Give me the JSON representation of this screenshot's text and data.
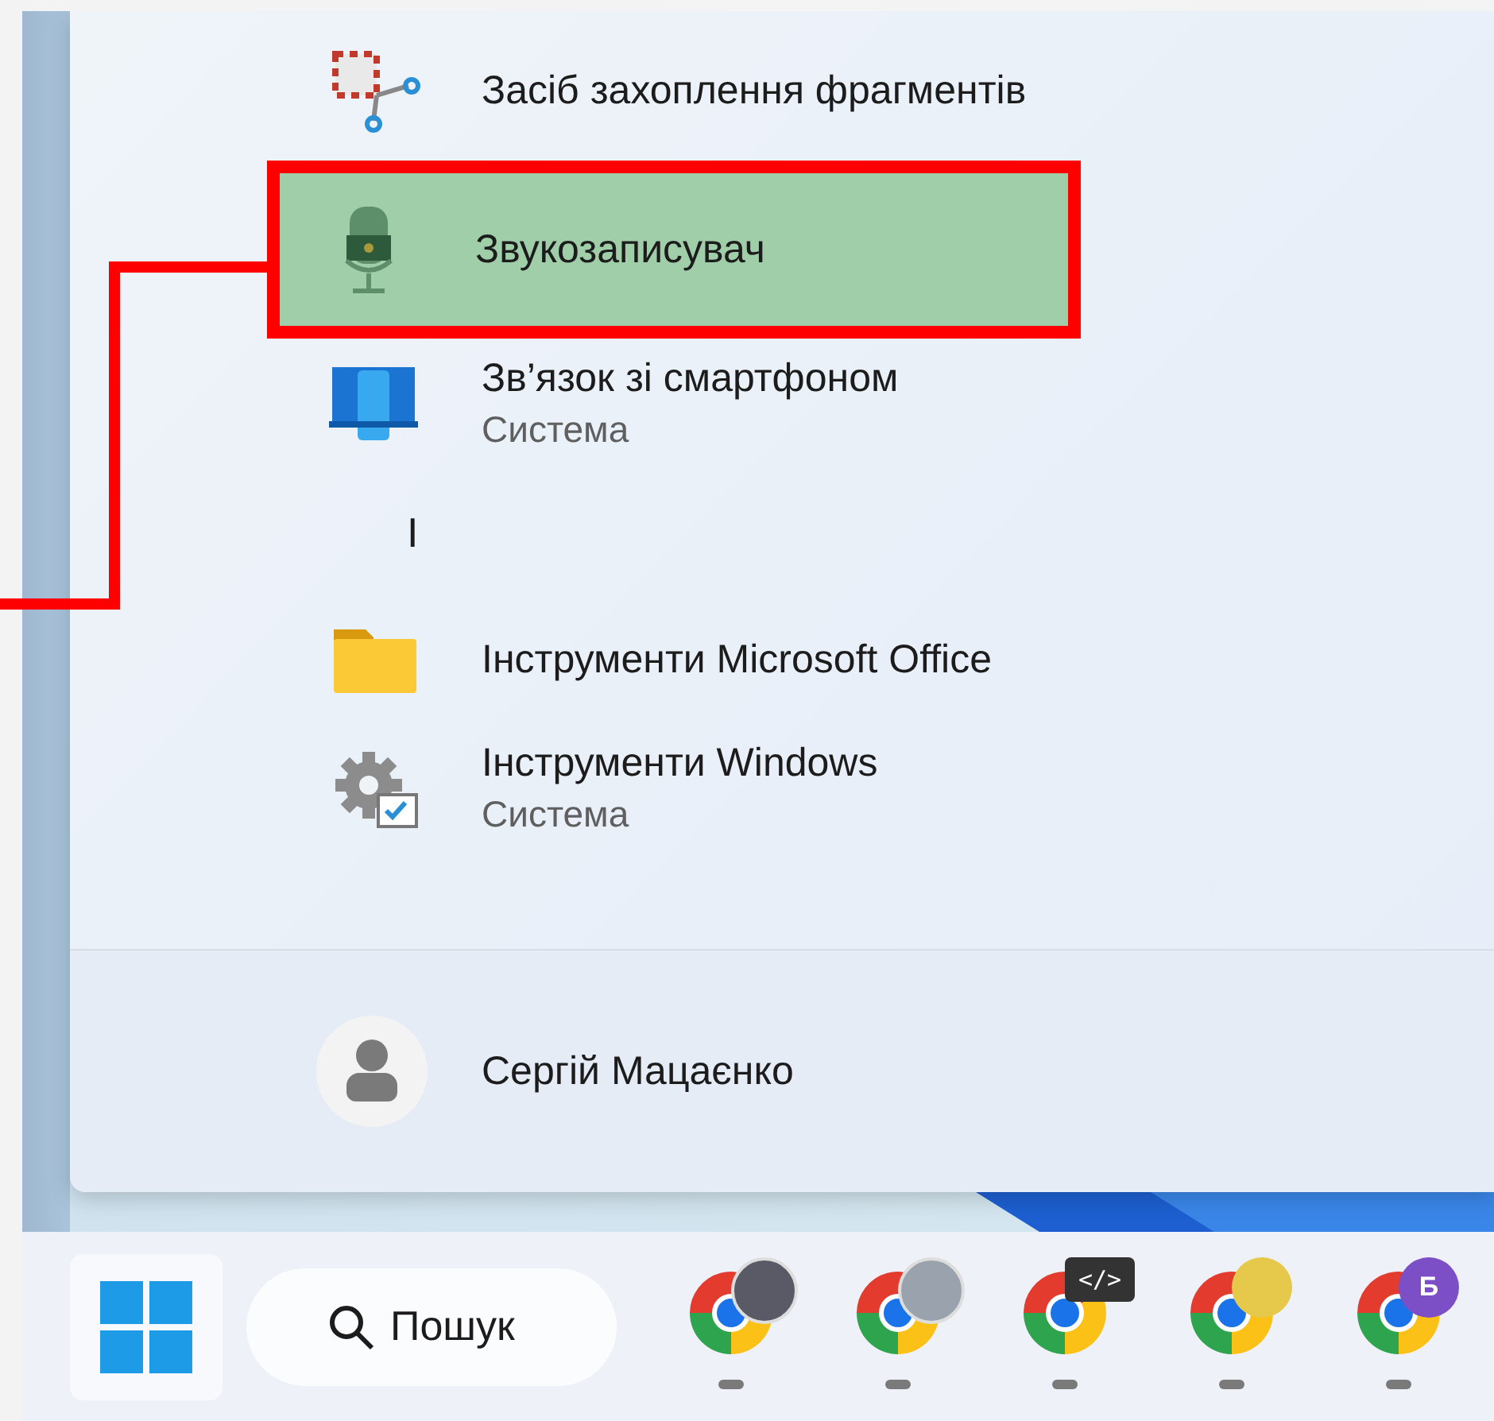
{
  "start_menu": {
    "items": [
      {
        "kind": "app",
        "name": "Засіб захоплення фрагментів",
        "highlighted": false
      },
      {
        "kind": "app",
        "name": "Звукозаписувач",
        "highlighted": true
      },
      {
        "kind": "app",
        "name": "Зв’язок зі смартфоном",
        "subtitle": "Система",
        "highlighted": false
      },
      {
        "kind": "letter",
        "name": "І"
      },
      {
        "kind": "app",
        "name": "Інструменти Microsoft Office",
        "highlighted": false
      },
      {
        "kind": "app",
        "name": "Інструменти Windows",
        "subtitle": "Система",
        "highlighted": false
      }
    ],
    "user": {
      "name": "Сергій Мацаєнко"
    }
  },
  "taskbar": {
    "search": {
      "placeholder": "Пошук"
    },
    "apps": [
      {
        "kind": "avatar"
      },
      {
        "kind": "avatar"
      },
      {
        "kind": "code",
        "badge_text": "</>"
      },
      {
        "kind": "emoji"
      },
      {
        "kind": "letter",
        "badge_text": "Б"
      }
    ]
  }
}
